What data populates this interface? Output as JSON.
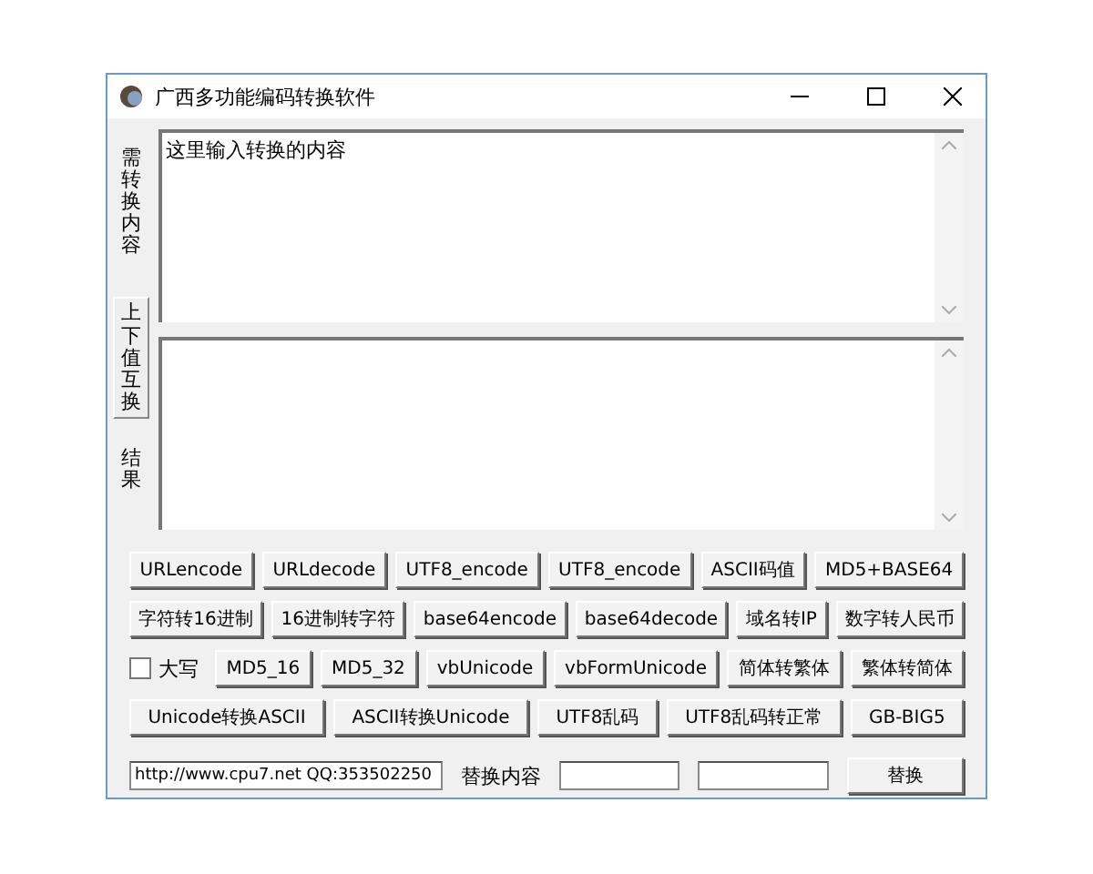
{
  "window": {
    "title": "广西多功能编码转换软件"
  },
  "side": {
    "input_label": "需转换内容",
    "swap_button": "上下值互换",
    "result_label": "结果"
  },
  "input": {
    "value": "这里输入转换的内容"
  },
  "button_rows": [
    {
      "items": [
        {
          "kind": "button",
          "label": "URLencode"
        },
        {
          "kind": "button",
          "label": "URLdecode"
        },
        {
          "kind": "button",
          "label": "UTF8_encode"
        },
        {
          "kind": "button",
          "label": "UTF8_encode"
        },
        {
          "kind": "button",
          "label": "ASCII码值"
        },
        {
          "kind": "button",
          "label": "MD5+BASE64"
        }
      ]
    },
    {
      "items": [
        {
          "kind": "button",
          "label": "字符转16进制"
        },
        {
          "kind": "button",
          "label": "16进制转字符"
        },
        {
          "kind": "button",
          "label": "base64encode"
        },
        {
          "kind": "button",
          "label": "base64decode"
        },
        {
          "kind": "button",
          "label": "域名转IP"
        },
        {
          "kind": "button",
          "label": "数字转人民币"
        }
      ]
    },
    {
      "items": [
        {
          "kind": "checkbox",
          "label": "大写",
          "checked": false
        },
        {
          "kind": "button",
          "label": "MD5_16"
        },
        {
          "kind": "button",
          "label": "MD5_32"
        },
        {
          "kind": "button",
          "label": "vbUnicode"
        },
        {
          "kind": "button",
          "label": "vbFormUnicode"
        },
        {
          "kind": "button",
          "label": "简体转繁体"
        },
        {
          "kind": "button",
          "label": "繁体转简体"
        }
      ]
    },
    {
      "items": [
        {
          "kind": "button",
          "label": "Unicode转换ASCII"
        },
        {
          "kind": "button",
          "label": "ASCII转换Unicode"
        },
        {
          "kind": "button",
          "label": "UTF8乱码"
        },
        {
          "kind": "button",
          "label": "UTF8乱码转正常"
        },
        {
          "kind": "button",
          "label": "GB-BIG5"
        }
      ]
    }
  ],
  "bottom": {
    "url_value": "http://www.cpu7.net QQ:353502250",
    "replace_label": "替换内容",
    "replace_button": "替换"
  }
}
